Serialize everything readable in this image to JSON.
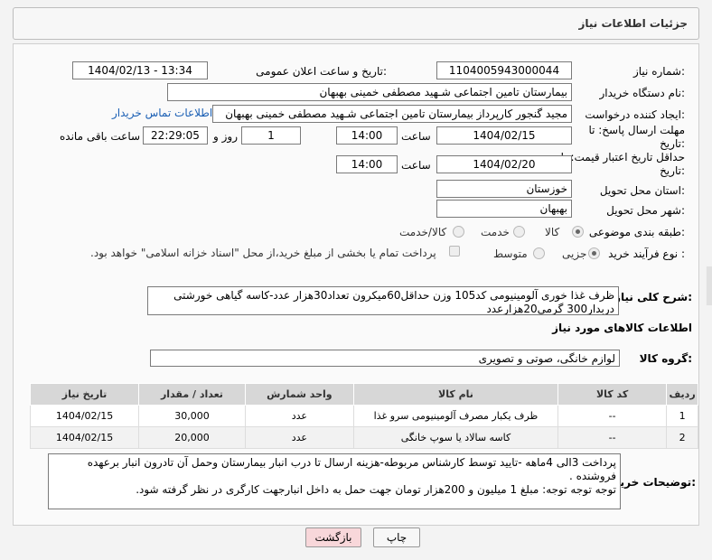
{
  "panel": {
    "title": "جزئیات اطلاعات نیاز"
  },
  "form": {
    "need_number_label": "شماره نیاز:",
    "need_number": "1104005943000044",
    "announce_label": "تاریخ و ساعت اعلان عمومی:",
    "announce_value": "1404/02/13 - 13:34",
    "buyer_org_label": "نام دستگاه خریدار:",
    "buyer_org": "بیمارستان تامین اجتماعی شـهید مصطفی خمینی بهبهان",
    "requester_label": "ایجاد کننده درخواست:",
    "requester": "مجید گنجور کارپرداز بیمارستان تامین اجتماعی شـهید مصطفی خمینی بهبهان",
    "contact_link": "اطلاعات تماس خریدار",
    "deadline_label": "مهلت ارسال پاسخ: تا تاریخ:",
    "deadline_date": "1404/02/15",
    "time_label": "ساعت",
    "deadline_time": "14:00",
    "days_value": "1",
    "days_label": "روز و",
    "remaining_time": "22:29:05",
    "remaining_label": "ساعت باقی مانده",
    "validity_label": "حداقل تاریخ اعتبار قیمت: تا تاریخ:",
    "validity_date": "1404/02/20",
    "validity_time": "14:00",
    "province_label": "استان محل تحویل:",
    "province": "خوزستان",
    "city_label": "شهر محل تحویل:",
    "city": "بهبهان",
    "category_label": "طبقه بندی موضوعی:",
    "category_options": [
      "کالا",
      "خدمت",
      "کالا/خدمت"
    ],
    "process_label": "نوع فرآیند خرید :",
    "process_options": [
      "جزیی",
      "متوسط"
    ],
    "payment_note": "پرداخت تمام یا بخشی از مبلغ خرید،از محل \"اسناد خزانه اسلامی\" خواهد بود."
  },
  "description": {
    "label": "شرح کلی نیاز:",
    "text": "ظرف غذا خوری آلومینیومی کد105 وزن حداقل60میکرون تعداد30هزار عدد-کاسه گیاهی خورشتی دربدار300 گرمی20هزارعدد"
  },
  "goods": {
    "section_title": "اطلاعات کالاهای مورد نیاز",
    "group_label": "گروه کالا:",
    "group_value": "لوازم خانگی، صوتی و تصویری"
  },
  "table": {
    "headers": [
      "ردیف",
      "کد کالا",
      "نام کالا",
      "واحد شمارش",
      "تعداد / مقدار",
      "تاریخ نیاز"
    ],
    "rows": [
      [
        "1",
        "--",
        "ظرف یکبار مصرف آلومینیومی سرو غذا",
        "عدد",
        "30,000",
        "1404/02/15"
      ],
      [
        "2",
        "--",
        "کاسه سالاد یا سوپ خانگی",
        "عدد",
        "20,000",
        "1404/02/15"
      ]
    ]
  },
  "buyer_notes": {
    "label": "توضیحات خریدار:",
    "line1": "پرداخت 3الی 4ماهه -تایید توسط کارشناس مربوطه-هزینه ارسال تا درب انبار بیمارستان وحمل آن تادرون انبار برعهده فروشنده .",
    "line2": "توجه توجه توجه: مبلغ 1 میلیون و 200هزار تومان جهت حمل به داخل انبارجهت کارگری در نظر گرفته شود."
  },
  "buttons": {
    "print": "چاپ",
    "back": "بازگشت"
  },
  "watermark_text": "AriaTender.neT",
  "colors": {
    "back_button_bg": "#f8d7da",
    "link": "#1a5fb4"
  }
}
